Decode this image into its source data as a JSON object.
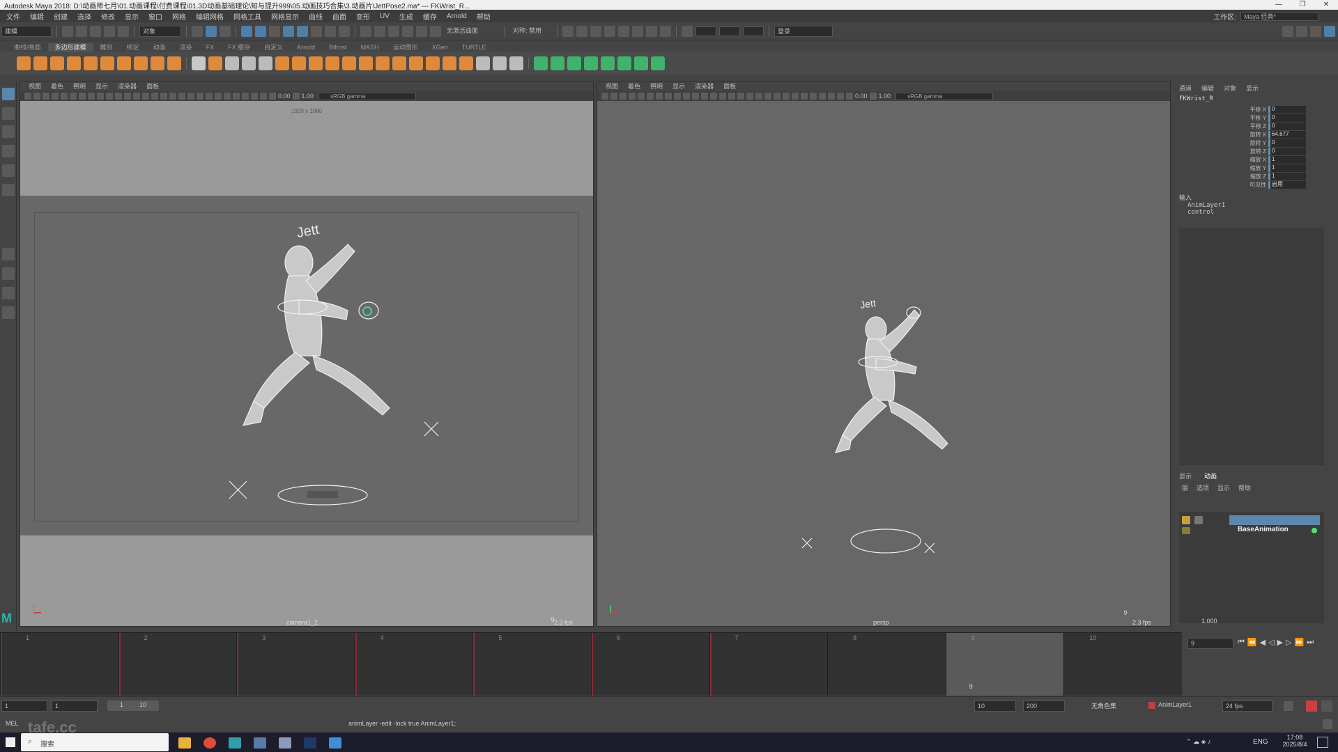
{
  "window": {
    "title": "Autodesk Maya 2018: D:\\动画师七月\\01.动画课程\\付费课程\\01.3D动画基础理论\\知与提升999\\05.动画技巧合集\\3.动画片\\JettPose2.ma*   ---   FKWrist_R...",
    "controls": [
      "—",
      "❐",
      "✕"
    ]
  },
  "menubar": {
    "items": [
      "文件",
      "编辑",
      "创建",
      "选择",
      "修改",
      "显示",
      "窗口",
      "网格",
      "编辑网格",
      "网格工具",
      "网格显示",
      "曲线",
      "曲面",
      "变形",
      "UV",
      "生成",
      "缓存",
      "Arnold",
      "帮助"
    ],
    "workspace_label": "工作区:",
    "workspace_value": "Maya 经典*"
  },
  "statusline": {
    "mode": "建模",
    "object_label": "对象",
    "no_live": "无激活曲面",
    "symmetry": "对称: 禁用",
    "login": "登录"
  },
  "shelf": {
    "tabs": [
      "曲线/曲面",
      "多边形建模",
      "雕刻",
      "绑定",
      "动画",
      "渲染",
      "FX",
      "FX 缓存",
      "自定义",
      "Arnold",
      "Bifrost",
      "MASH",
      "运动图形",
      "XGen",
      "TURTLE"
    ],
    "active_tab": "多边形建模",
    "icon_colors": [
      "#e0893a",
      "#e0893a",
      "#e0893a",
      "#e0893a",
      "#e0893a",
      "#e0893a",
      "#e0893a",
      "#e0893a",
      "#e0893a",
      "#e0893a",
      "#c8c8c8",
      "#e0893a",
      "#bbbbbb",
      "#bbbbbb",
      "#bbbbbb",
      "#e0893a",
      "#e0893a",
      "#e0893a",
      "#e0893a",
      "#e0893a",
      "#e0893a",
      "#e0893a",
      "#e0893a",
      "#e0893a",
      "#e0893a",
      "#e0893a",
      "#e0893a",
      "#bbbbbb",
      "#bbbbbb",
      "#bbbbbb",
      "#3fb36b",
      "#3fb36b",
      "#3fb36b",
      "#3fb36b",
      "#3fb36b",
      "#3fb36b",
      "#3fb36b",
      "#3fb36b"
    ]
  },
  "viewport_left": {
    "menu": [
      "视图",
      "着色",
      "照明",
      "显示",
      "渲染器",
      "面板"
    ],
    "exposure": "0.00",
    "gamma": "1.00",
    "colorspace": "sRGB gamma",
    "resolution": "1920 x 1080",
    "camera": "camera1_2",
    "frame": "9",
    "fps": "2.3 fps",
    "character_label": "Jett"
  },
  "viewport_right": {
    "menu": [
      "视图",
      "着色",
      "照明",
      "显示",
      "渲染器",
      "面板"
    ],
    "exposure": "0.00",
    "gamma": "1.00",
    "colorspace": "sRGB gamma",
    "camera": "persp",
    "frame": "9",
    "fps": "2.3 fps",
    "character_label": "Jett"
  },
  "channelbox": {
    "tabs": [
      "通道",
      "编辑",
      "对象",
      "显示"
    ],
    "object": "FKWrist_R",
    "channels": [
      {
        "label": "平移 X",
        "value": "0"
      },
      {
        "label": "平移 Y",
        "value": "0"
      },
      {
        "label": "平移 Z",
        "value": "0"
      },
      {
        "label": "旋转 X",
        "value": "64.677"
      },
      {
        "label": "旋转 Y",
        "value": "0"
      },
      {
        "label": "旋转 Z",
        "value": "0"
      },
      {
        "label": "缩放 X",
        "value": "1"
      },
      {
        "label": "缩放 Y",
        "value": "1"
      },
      {
        "label": "缩放 Z",
        "value": "1"
      },
      {
        "label": "可见性",
        "value": "启用"
      }
    ],
    "inputs_label": "输入",
    "inputs": [
      "AnimLayer1",
      "control"
    ]
  },
  "layer_editor": {
    "tabs": [
      "显示",
      "动画"
    ],
    "menu": [
      "层",
      "选项",
      "显示",
      "帮助"
    ],
    "layers": [
      "",
      "BaseAnimation"
    ],
    "weight": "1.000"
  },
  "timeslider": {
    "frames": [
      "1",
      "2",
      "3",
      "4",
      "5",
      "6",
      "7",
      "8",
      "9",
      "10"
    ],
    "current_frame": "9",
    "current_field": "9"
  },
  "rangebar": {
    "start": "1",
    "start2": "1",
    "range_start": "1",
    "range_end": "10",
    "end": "10",
    "end2": "200",
    "char_set": "无角色集",
    "anim_layer": "AnimLayer1",
    "fps": "24 fps"
  },
  "cmdline": {
    "lang": "MEL",
    "command": "animLayer -edit -lock true AnimLayer1;",
    "watermark": "tafe.cc"
  },
  "taskbar": {
    "search": "搜索",
    "lang": "ENG",
    "time": "17:08",
    "date": "2025/8/4"
  }
}
